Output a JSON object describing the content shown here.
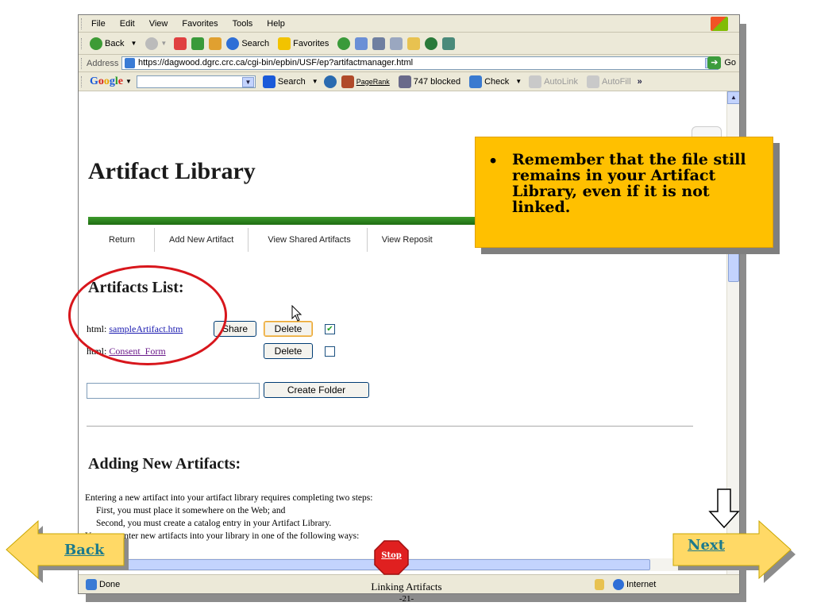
{
  "menu": [
    "File",
    "Edit",
    "View",
    "Favorites",
    "Tools",
    "Help"
  ],
  "toolbar": {
    "back": "Back",
    "search": "Search",
    "favorites": "Favorites"
  },
  "address": {
    "label": "Address",
    "url": "https://dagwood.dgrc.crc.ca/cgi-bin/epbin/USF/ep?artifactmanager.html",
    "go": "Go"
  },
  "google": {
    "logo": "Google",
    "search": "Search",
    "pagerank": "PageRank",
    "blocked": "747 blocked",
    "check": "Check",
    "autolink": "AutoLink",
    "autofill": "AutoFill"
  },
  "page": {
    "title": "Artifact Library",
    "tabs": [
      "Return",
      "Add New Artifact",
      "View Shared Artifacts",
      "View Reposit"
    ],
    "list_heading": "Artifacts List:",
    "items": [
      {
        "type": "html:",
        "name": "sampleArtifact.htm",
        "share": "Share",
        "delete": "Delete",
        "checked": true
      },
      {
        "type": "html:",
        "name": "Consent_Form",
        "delete": "Delete",
        "checked": false
      }
    ],
    "create_folder": "Create Folder",
    "adding_heading": "Adding New Artifacts:",
    "lines": [
      "Entering a new artifact into your artifact library requires completing two steps:",
      "First, you must place it somewhere on the Web; and",
      "Second, you must create a catalog entry in your Artifact Library.",
      "You may enter new artifacts into your library in one of the following ways:"
    ]
  },
  "status": {
    "done": "Done",
    "zone": "Internet"
  },
  "callout": {
    "bullet": "•",
    "text": "Remember that the file still remains in your Artifact Library, even if it is not linked."
  },
  "nav": {
    "back": "Back",
    "next": "Next",
    "stop": "Stop"
  },
  "slide": {
    "caption": "Linking Artifacts",
    "page": "-21-"
  },
  "colors": {
    "callout": "#ffc000",
    "nav_arrow": "#ffd966",
    "green_bar": "#2e8b22",
    "ellipse": "#d8161c"
  }
}
